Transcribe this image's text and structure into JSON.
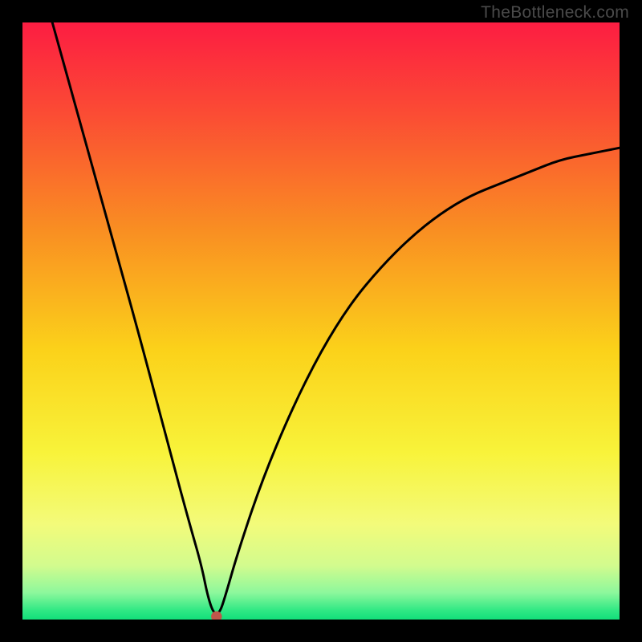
{
  "watermark": "TheBottleneck.com",
  "chart_data": {
    "type": "line",
    "title": "",
    "xlabel": "",
    "ylabel": "",
    "xlim": [
      0,
      100
    ],
    "ylim": [
      0,
      100
    ],
    "grid": false,
    "legend": false,
    "note": "Axes are unlabeled in the source image. Values below are read off as approximate percentages of the plot width/height (0–100). Minimum of the black curve occurs at roughly x≈32.",
    "series": [
      {
        "name": "curve",
        "color": "#000000",
        "x": [
          5,
          10,
          15,
          20,
          25,
          28,
          30,
          31,
          32,
          33,
          34,
          36,
          40,
          45,
          50,
          55,
          60,
          65,
          70,
          75,
          80,
          85,
          90,
          95,
          100
        ],
        "y": [
          100,
          82,
          64,
          46,
          27,
          16,
          9,
          4,
          1,
          1,
          4,
          11,
          23,
          35,
          45,
          53,
          59,
          64,
          68,
          71,
          73,
          75,
          77,
          78,
          79
        ]
      }
    ],
    "marker": {
      "x": 32.5,
      "y": 0.5,
      "color": "#c0564a",
      "radius_pct": 0.9
    },
    "background": {
      "description": "vertical rainbow gradient, red at top through orange/yellow to green at bottom, with a brighter green band near the very bottom",
      "stops": [
        {
          "offset": 0.0,
          "color": "#fc1d42"
        },
        {
          "offset": 0.15,
          "color": "#fb4b34"
        },
        {
          "offset": 0.35,
          "color": "#f98f22"
        },
        {
          "offset": 0.55,
          "color": "#fbd21a"
        },
        {
          "offset": 0.72,
          "color": "#f8f33a"
        },
        {
          "offset": 0.84,
          "color": "#f3fb7a"
        },
        {
          "offset": 0.91,
          "color": "#d2fb8e"
        },
        {
          "offset": 0.955,
          "color": "#8df89c"
        },
        {
          "offset": 0.985,
          "color": "#2fe884"
        },
        {
          "offset": 1.0,
          "color": "#12df7a"
        }
      ]
    }
  }
}
